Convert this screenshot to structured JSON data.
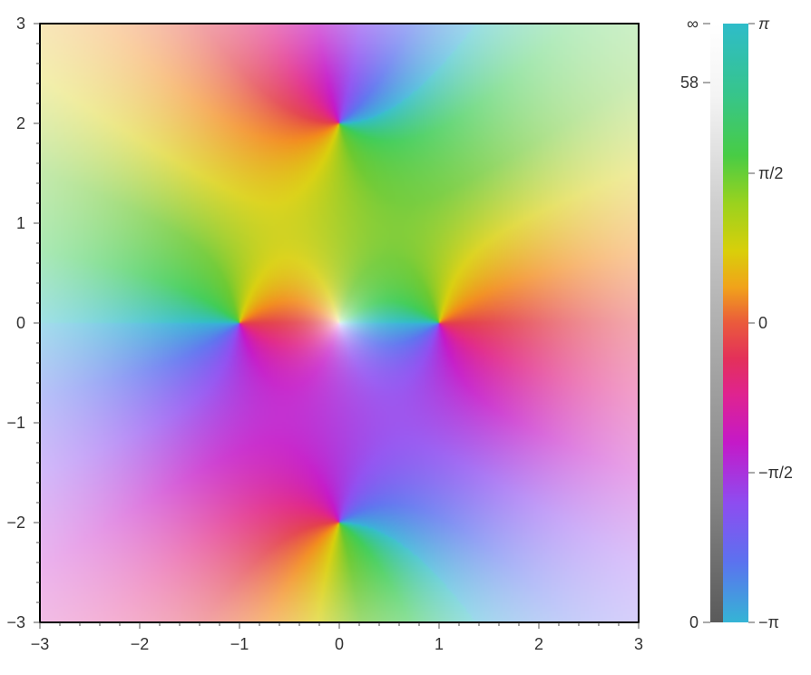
{
  "chart_data": {
    "type": "heatmap",
    "title": "",
    "xlabel": "",
    "ylabel": "",
    "xlim": [
      -3,
      3
    ],
    "ylim": [
      -3,
      3
    ],
    "x_ticks": [
      -3,
      -2,
      -1,
      0,
      1,
      2,
      3
    ],
    "y_ticks": [
      -3,
      -2,
      -1,
      0,
      1,
      2,
      3
    ],
    "x_tick_labels": [
      "−3",
      "−2",
      "−1",
      "0",
      "1",
      "2",
      "3"
    ],
    "y_tick_labels": [
      "−3",
      "−2",
      "−1",
      "0",
      "1",
      "2",
      "3"
    ],
    "grid": false,
    "zeros": [
      {
        "x": 1,
        "y": 0
      },
      {
        "x": -1,
        "y": 0
      },
      {
        "x": 0,
        "y": 2
      },
      {
        "x": 0,
        "y": -2
      }
    ],
    "poles": [
      {
        "x": 0,
        "y": 0
      }
    ],
    "colorbars": {
      "magnitude": {
        "labels": [
          "∞",
          "58",
          "0"
        ],
        "colors": [
          "#ffffff",
          "#d0d0d0",
          "#5a5a5a"
        ]
      },
      "phase": {
        "labels": [
          "π",
          "π/2",
          "0",
          "−π/2",
          "−π"
        ],
        "colors": [
          "#2ebcc9",
          "#3dcc55",
          "#6ac82c",
          "#d9cf0a",
          "#f28a18",
          "#e33f4a",
          "#e02488",
          "#c418c8",
          "#8f4cf0",
          "#5c72ef",
          "#36b2d6"
        ]
      }
    }
  }
}
